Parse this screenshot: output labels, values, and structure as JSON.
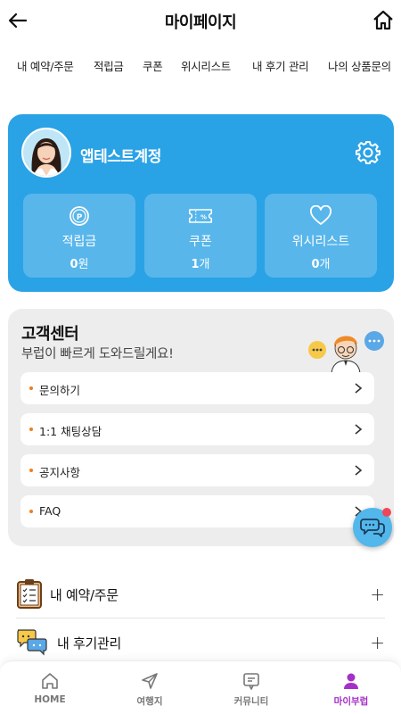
{
  "header": {
    "title": "마이페이지",
    "back_icon": "arrow-left-icon",
    "home_icon": "home-icon"
  },
  "tabs": [
    "내 예약/주문",
    "적립금",
    "쿠폰",
    "위시리스트",
    "내 후기 관리",
    "나의 상품문의"
  ],
  "profile": {
    "account_name": "앱테스트계정",
    "stats": [
      {
        "label": "적립금",
        "value": "0",
        "unit": "원",
        "icon": "points-icon"
      },
      {
        "label": "쿠폰",
        "value": "1",
        "unit": "개",
        "icon": "coupon-icon"
      },
      {
        "label": "위시리스트",
        "value": "0",
        "unit": "개",
        "icon": "heart-icon"
      }
    ]
  },
  "support": {
    "title": "고객센터",
    "subtitle": "부럽이 빠르게 도와드릴게요!",
    "items": [
      "문의하기",
      "1:1 채팅상담",
      "공지사항",
      "FAQ"
    ]
  },
  "menu": [
    {
      "label": "내 예약/주문",
      "icon": "clipboard-icon"
    },
    {
      "label": "내 후기관리",
      "icon": "review-chat-icon"
    }
  ],
  "bottom_nav": [
    {
      "label": "HOME",
      "icon": "home-icon"
    },
    {
      "label": "여행지",
      "icon": "send-icon"
    },
    {
      "label": "커뮤니티",
      "icon": "community-icon"
    },
    {
      "label": "마이부럽",
      "icon": "person-icon",
      "active": true
    }
  ],
  "colors": {
    "accent": "#2aa2e6",
    "active_nav": "#a52fc7",
    "bullet": "#f07d1a",
    "badge": "#f0465a"
  }
}
